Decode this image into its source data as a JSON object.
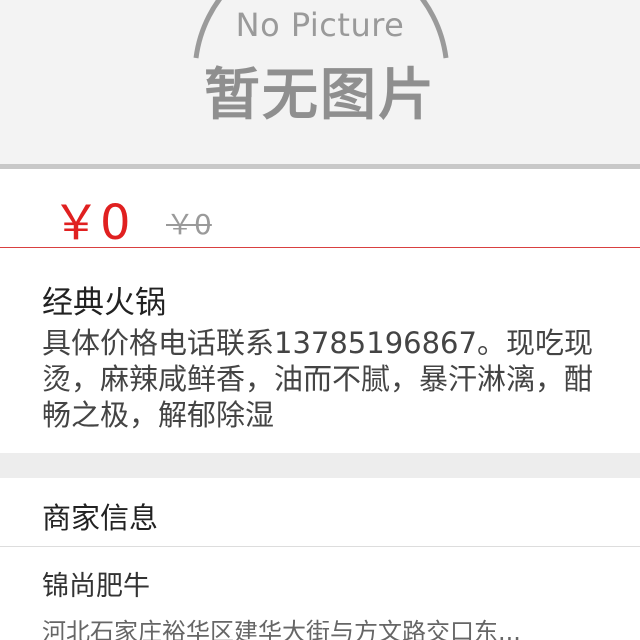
{
  "image_placeholder": {
    "english": "No Picture",
    "chinese": "暂无图片"
  },
  "price": {
    "current": "￥0",
    "original": "￥0"
  },
  "product": {
    "name": "经典火锅",
    "description": "具体价格电话联系13785196867。现吃现烫，麻辣咸鲜香，油而不腻，暴汗淋漓，酣畅之极，解郁除湿"
  },
  "merchant": {
    "section_title": "商家信息",
    "name": "锦尚肥牛",
    "address": "河北石家庄裕华区建华大街与方文路交口东..."
  },
  "colors": {
    "price": "#e02020",
    "divider_accent": "#d94040",
    "background_gray": "#f3f3f3"
  }
}
